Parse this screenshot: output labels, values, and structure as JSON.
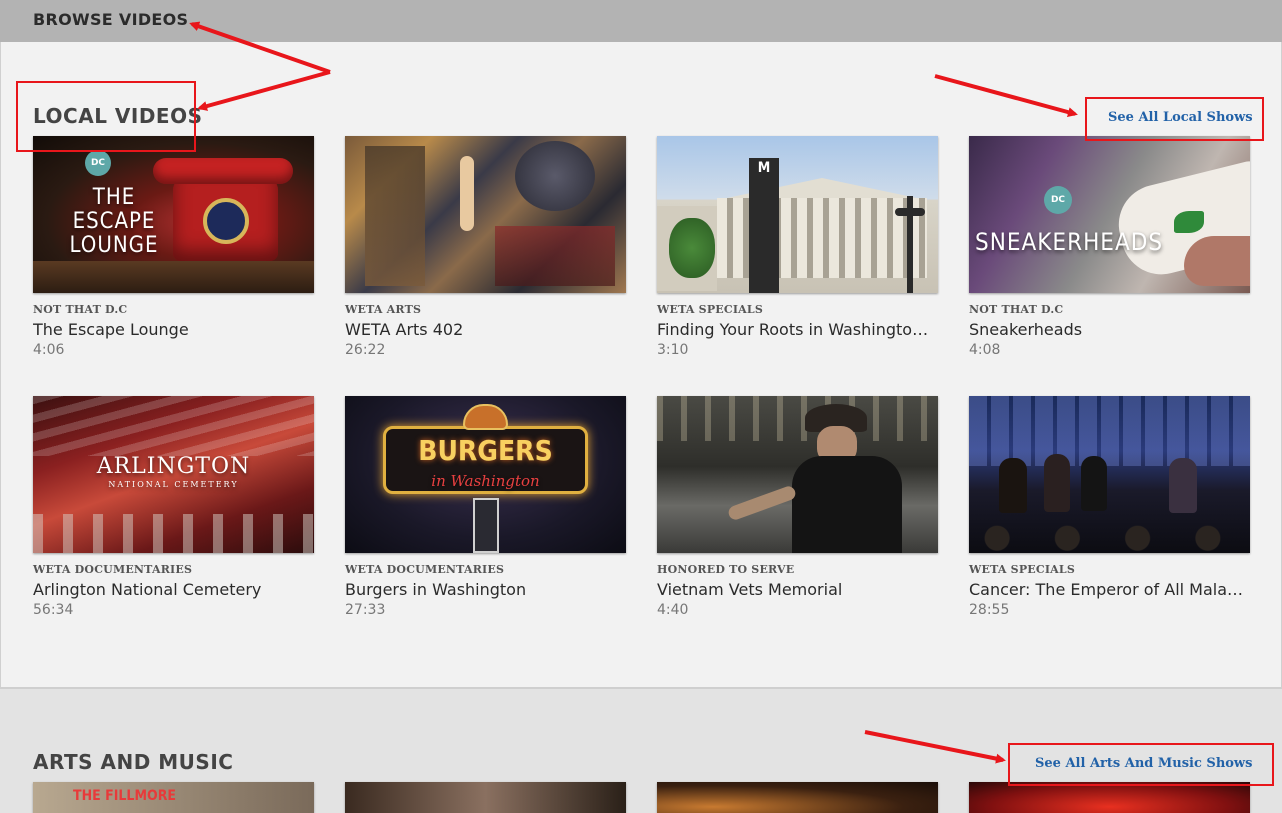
{
  "header": {
    "title": "BROWSE VIDEOS"
  },
  "local": {
    "title": "LOCAL VIDEOS",
    "see_all": "See All Local Shows",
    "videos": [
      {
        "category": "NOT THAT D.C",
        "title": "The Escape Lounge",
        "duration": "4:06",
        "thumb_text": "THE ESCAPE LOUNGE",
        "badge": "DC"
      },
      {
        "category": "WETA ARTS",
        "title": "WETA Arts 402",
        "duration": "26:22"
      },
      {
        "category": "WETA SPECIALS",
        "title": "Finding Your Roots in Washington: ...",
        "duration": "3:10",
        "thumb_text": "M"
      },
      {
        "category": "NOT THAT D.C",
        "title": "Sneakerheads",
        "duration": "4:08",
        "thumb_text": "SNEAKERHEADS",
        "badge": "DC"
      },
      {
        "category": "WETA DOCUMENTARIES",
        "title": "Arlington National Cemetery",
        "duration": "56:34",
        "thumb_text": "ARLINGTON",
        "thumb_sub": "NATIONAL CEMETERY"
      },
      {
        "category": "WETA DOCUMENTARIES",
        "title": "Burgers in Washington",
        "duration": "27:33",
        "thumb_text": "BURGERS",
        "thumb_sub": "in Washington"
      },
      {
        "category": "HONORED TO SERVE",
        "title": "Vietnam Vets Memorial",
        "duration": "4:40"
      },
      {
        "category": "WETA SPECIALS",
        "title": "Cancer: The Emperor of All Maladie...",
        "duration": "28:55"
      }
    ]
  },
  "arts": {
    "title": "ARTS AND MUSIC",
    "see_all": "See All Arts And Music Shows",
    "thumb_texts": [
      "THE FILLMORE"
    ]
  },
  "colors": {
    "annotation": "#e8161b",
    "link": "#2262a8",
    "topbar": "#b3b3b3"
  }
}
